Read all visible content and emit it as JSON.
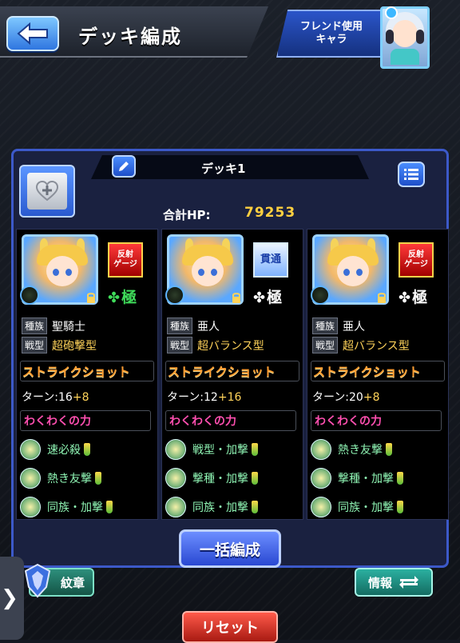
{
  "header": {
    "title": "デッキ編成",
    "friend_button": "フレンド使用\nキャラ"
  },
  "deck": {
    "name": "デッキ1",
    "total_hp_label": "合計HP:",
    "total_hp": "79253"
  },
  "cards": [
    {
      "ability": "反射\nゲージ",
      "ability_type": "reflect",
      "grade": "極",
      "grade_color": "#3fdc5a",
      "race_label": "種族",
      "race": "聖騎士",
      "type_label": "戦型",
      "type": "超砲撃型",
      "strike_shot": "ストライクショット",
      "turns_label": "ターン:16",
      "turns_plus": "+8",
      "waku_title": "わくわくの力",
      "waku": [
        "速必殺",
        "熱き友撃",
        "同族・加撃"
      ]
    },
    {
      "ability": "貫通",
      "ability_type": "pierce",
      "grade": "極",
      "grade_color": "#ffffff",
      "race_label": "種族",
      "race": "亜人",
      "type_label": "戦型",
      "type": "超バランス型",
      "strike_shot": "ストライクショット",
      "turns_label": "ターン:12",
      "turns_plus": "+16",
      "waku_title": "わくわくの力",
      "waku": [
        "戦型・加撃",
        "撃種・加撃",
        "同族・加撃"
      ]
    },
    {
      "ability": "反射\nゲージ",
      "ability_type": "reflect",
      "grade": "極",
      "grade_color": "#ffffff",
      "race_label": "種族",
      "race": "亜人",
      "type_label": "戦型",
      "type": "超バランス型",
      "strike_shot": "ストライクショット",
      "turns_label": "ターン:20",
      "turns_plus": "+8",
      "waku_title": "わくわくの力",
      "waku": [
        "熱き友撃",
        "撃種・加撃",
        "同族・加撃"
      ]
    }
  ],
  "buttons": {
    "bulk": "一括編成",
    "crest": "紋章",
    "info": "情報",
    "reset": "リセット"
  },
  "icons": {
    "back": "back-arrow-icon",
    "edit": "pencil-icon",
    "menu": "list-icon",
    "item": "heart-plus-icon",
    "lock": "lock-icon",
    "swap": "swap-arrows-icon",
    "side": "chevron-right-icon"
  }
}
